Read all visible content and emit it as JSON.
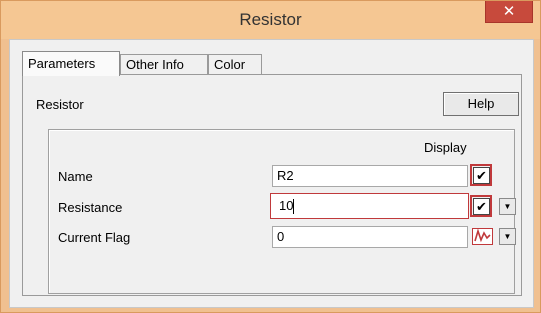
{
  "window": {
    "title": "Resistor",
    "close_glyph": "✕"
  },
  "tabs": [
    {
      "label": "Parameters",
      "active": true
    },
    {
      "label": "Other Info",
      "active": false
    },
    {
      "label": "Color",
      "active": false
    }
  ],
  "panel": {
    "title": "Resistor",
    "help_label": "Help",
    "display_header": "Display"
  },
  "rows": [
    {
      "label": "Name",
      "value": "R2",
      "display_checked": true
    },
    {
      "label": "Resistance",
      "value": "10",
      "display_checked": true
    },
    {
      "label": "Current Flag",
      "value": "0",
      "display_icon": "current-flag-icon"
    }
  ],
  "colors": {
    "focus_highlight": "#c0393b",
    "title_bar": "#f5c793",
    "close_button": "#c74a3c"
  }
}
